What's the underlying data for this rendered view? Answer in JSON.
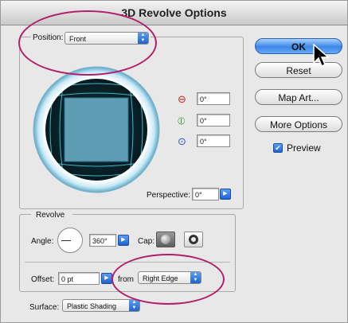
{
  "window": {
    "title": "3D Revolve Options"
  },
  "position": {
    "label": "Position:",
    "selected": "Front",
    "x_rotation": "0°",
    "y_rotation": "0°",
    "z_rotation": "0°",
    "perspective_label": "Perspective:",
    "perspective_value": "0°"
  },
  "revolve": {
    "section_label": "Revolve",
    "angle_label": "Angle:",
    "angle_value": "360°",
    "cap_label": "Cap:",
    "offset_label": "Offset:",
    "offset_value": "0 pt",
    "from_label": "from",
    "from_value": "Right Edge"
  },
  "surface": {
    "label": "Surface:",
    "value": "Plastic Shading"
  },
  "buttons": {
    "ok": "OK",
    "reset": "Reset",
    "map_art": "Map Art...",
    "more_options": "More Options"
  },
  "preview": {
    "label": "Preview",
    "checked": true
  },
  "colors": {
    "highlight_ellipse": "#b3206a",
    "cube_face": "#5f9db5",
    "track_dark": "#0b2a33",
    "accent_blue": "#2f75e0"
  }
}
